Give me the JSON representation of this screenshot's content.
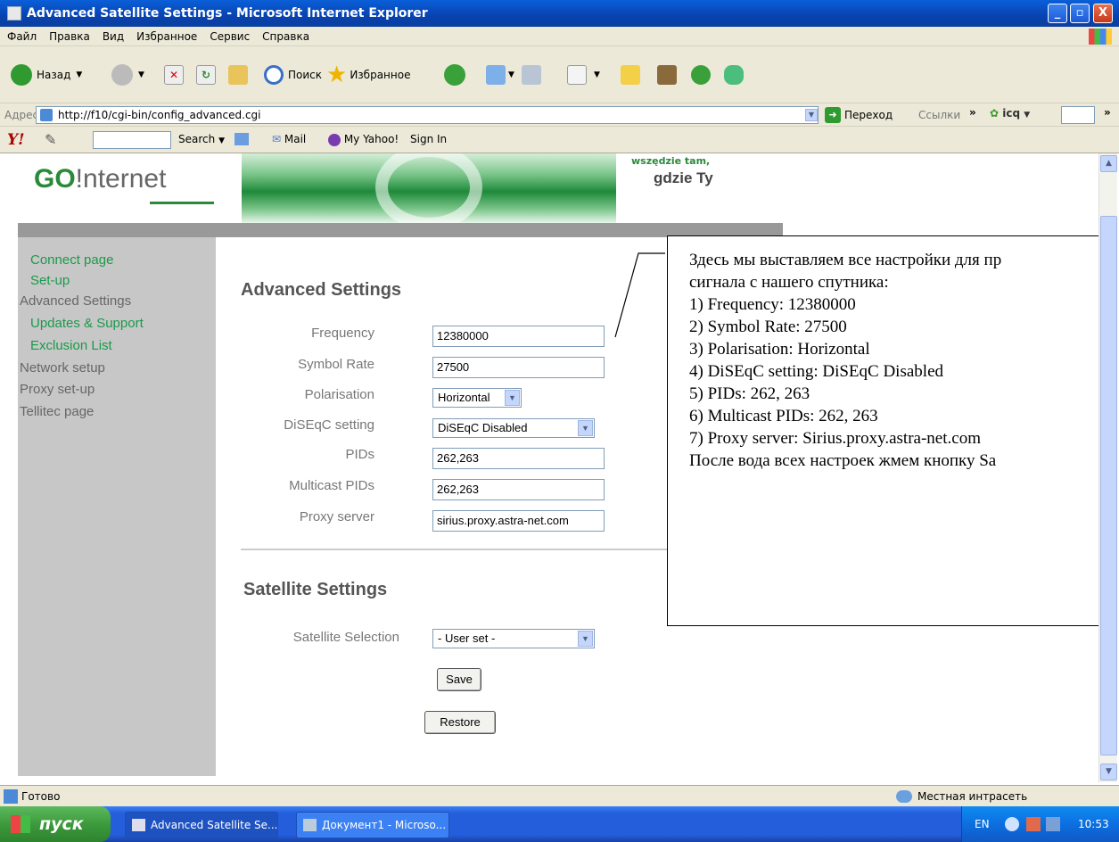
{
  "window": {
    "title": "Advanced Satellite Settings - Microsoft Internet Explorer",
    "buttons": {
      "minimize": "_",
      "maximize": "▫",
      "close": "X"
    }
  },
  "menu": [
    "Файл",
    "Правка",
    "Вид",
    "Избранное",
    "Сервис",
    "Справка"
  ],
  "toolbar": {
    "back": "Назад",
    "search": "Поиск",
    "favorites": "Избранное"
  },
  "address": {
    "label": "Адрес:",
    "url": "http://f10/cgi-bin/config_advanced.cgi",
    "go": "Переход",
    "links": "Ссылки",
    "chevron": "»",
    "icq": "icq"
  },
  "yahoo": {
    "logo": "Y!",
    "search": "Search",
    "mail": "Mail",
    "my_yahoo": "My Yahoo!",
    "sign_in": "Sign In"
  },
  "page": {
    "logo_go": "GO",
    "logo_rest": "!nternet",
    "slogan_line1": "wszędzie tam,",
    "slogan_line2": "gdzie Ty",
    "nav": [
      {
        "label": "Connect page",
        "color": "green"
      },
      {
        "label": "Set-up",
        "color": "green"
      },
      {
        "label": "Advanced Settings",
        "color": "gray"
      },
      {
        "label": "Updates & Support",
        "color": "green"
      },
      {
        "label": "Exclusion List",
        "color": "green"
      },
      {
        "label": "Network setup",
        "color": "gray"
      },
      {
        "label": "Proxy set-up",
        "color": "gray"
      },
      {
        "label": "Tellitec page",
        "color": "gray"
      }
    ],
    "advanced_title": "Advanced Settings",
    "fields": {
      "frequency_label": "Frequency",
      "frequency_value": "12380000",
      "symbol_rate_label": "Symbol Rate",
      "symbol_rate_value": "27500",
      "polarisation_label": "Polarisation",
      "polarisation_value": "Horizontal",
      "diseqc_label": "DiSEqC setting",
      "diseqc_value": "DiSEqC Disabled",
      "pids_label": "PIDs",
      "pids_value": "262,263",
      "multicast_label": "Multicast PIDs",
      "multicast_value": "262,263",
      "proxy_label": "Proxy server",
      "proxy_value": "sirius.proxy.astra-net.com"
    },
    "satellite_title": "Satellite Settings",
    "satellite_label": "Satellite Selection",
    "satellite_value": "- User set -",
    "save": "Save",
    "restore": "Restore"
  },
  "callout": {
    "lines": [
      "Здесь мы выставляем все настройки для пр",
      "сигнала с нашего спутника:",
      "1) Frequency: 12380000",
      "2) Symbol Rate: 27500",
      "3) Polarisation: Horizontal",
      "4) DiSEqC setting: DiSEqC Disabled",
      "5) PIDs: 262, 263",
      "6) Multicast PIDs: 262, 263",
      "7) Proxy server: Sirius.proxy.astra-net.com",
      "После вода всех настроек жмем кнопку Sa"
    ]
  },
  "status": {
    "text": "Готово",
    "zone": "Местная интрасеть"
  },
  "taskbar": {
    "start": "пуск",
    "tasks": [
      "Advanced Satellite Se...",
      "Документ1 - Microso..."
    ],
    "lang": "EN",
    "clock": "10:53"
  },
  "colors": {
    "nav_green": "#1a9a4a",
    "nav_gray": "#666666",
    "sidebar_bg": "#c7c7c7",
    "title_bar": "#0842b0"
  }
}
